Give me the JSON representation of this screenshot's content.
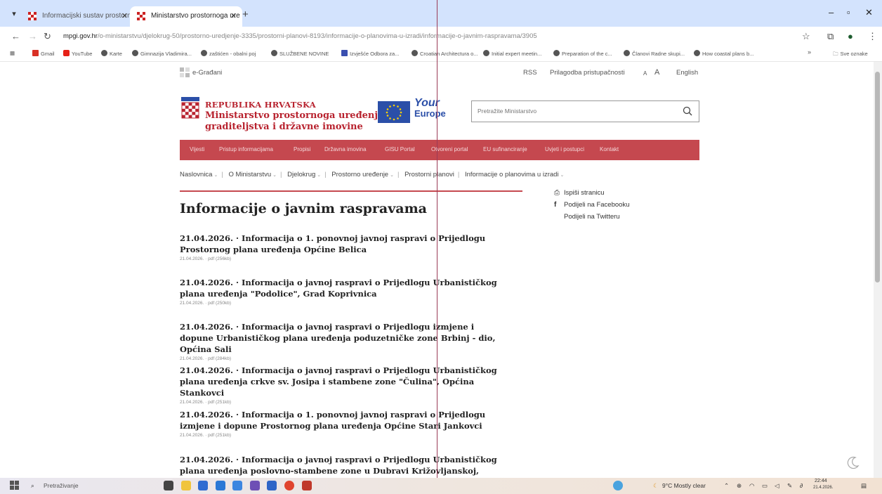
{
  "browser": {
    "tabs": [
      {
        "title": "Informacijski sustav prostorno",
        "active": false
      },
      {
        "title": "Ministarstvo prostornoga ure",
        "active": true
      }
    ],
    "url_host": "mpgi.gov.hr",
    "url_path": "/o-ministarstvu/djelokrug-50/prostorno-uredjenje-3335/prostorni-planovi-8193/informacije-o-planovima-u-izradi/informacije-o-javnim-raspravama/3905",
    "bookmarks": [
      "Gmail",
      "YouTube",
      "Karte",
      "Gimnazija Vladimira...",
      "zaštićen - obalni poj",
      "SLUŽBENE NOVINE",
      "Izvješće Odbora za...",
      "Croatian Architectura o...",
      "Initial expert meetin...",
      "Preparation of the c...",
      "Članovi Radne skupi...",
      "How coastal plans b...",
      "Sve oznake"
    ],
    "bookmark_more": "»"
  },
  "page": {
    "top_link": "e-Građani",
    "top_right": {
      "rss": "RSS",
      "accessibility": "Prilagodba pristupačnosti",
      "font_small": "A",
      "font_large": "A",
      "language": "English"
    },
    "logo": {
      "line1": "REPUBLIKA HRVATSKA",
      "line2": "Ministarstvo prostornoga uređenja,",
      "line3": "graditeljstva i državne imovine"
    },
    "your_europe": {
      "line1": "Your",
      "line2": "Europe"
    },
    "search_placeholder": "Pretražite Ministarstvo",
    "main_nav": [
      "Vijesti",
      "Pristup informacijama",
      "Propisi",
      "Državna imovina",
      "GISU Portal",
      "Otvoreni portal",
      "EU sufinanciranje",
      "Uvjeti i postupci",
      "Kontakt"
    ],
    "breadcrumbs": [
      "Naslovnica",
      "O Ministarstvu",
      "Djelokrug",
      "Prostorno uređenje",
      "Prostorni planovi",
      "Informacije o planovima u izradi"
    ],
    "title": "Informacije o javnim raspravama",
    "side_links": [
      "Ispiši stranicu",
      "Podijeli na Facebooku",
      "Podijeli na Twitteru"
    ],
    "news": [
      {
        "headline": "21.04.2026. · Informacija o 1. ponovnoj javnoj raspravi o Prijedlogu Prostornog plana uređenja Općine Belica",
        "meta": "21.04.2026. · pdf (256kb)"
      },
      {
        "headline": "21.04.2026. · Informacija o javnoj raspravi o Prijedlogu Urbanističkog plana uređenja \"Podolice\", Grad Koprivnica",
        "meta": "21.04.2026. · pdf (250kb)"
      },
      {
        "headline": "21.04.2026. · Informacija o javnoj raspravi o Prijedlogu izmjene i dopune Urbanističkog plana uređenja poduzetničke zone Brbinj - dio, Općina Sali",
        "meta": "21.04.2026. · pdf (284kb)"
      },
      {
        "headline": "21.04.2026. · Informacija o javnoj raspravi o Prijedlogu Urbanističkog plana uređenja crkve sv. Josipa i stambene zone \"Čulina\", Općina Stankovci",
        "meta": "21.04.2026. · pdf (251kb)"
      },
      {
        "headline": "21.04.2026. · Informacija o 1. ponovnoj javnoj raspravi o Prijedlogu izmjene i dopune Prostornog plana uređenja Općine Stari Jankovci",
        "meta": "21.04.2026. · pdf (251kb)"
      },
      {
        "headline": "21.04.2026. · Informacija o javnoj raspravi o Prijedlogu Urbanističkog plana uređenja poslovno-stambene zone u Dubravi Križovljanskoj, Općina Cestica",
        "meta": ""
      }
    ]
  },
  "taskbar": {
    "search_placeholder": "Pretraživanje",
    "weather": "9°C Mostly clear",
    "time": "22:44",
    "date": "21.4.2026."
  },
  "colors": {
    "accent_red": "#c5484f",
    "logo_red": "#b8232f",
    "eu_blue": "#2b4fa8",
    "tab_strip": "#d3e3fd"
  }
}
